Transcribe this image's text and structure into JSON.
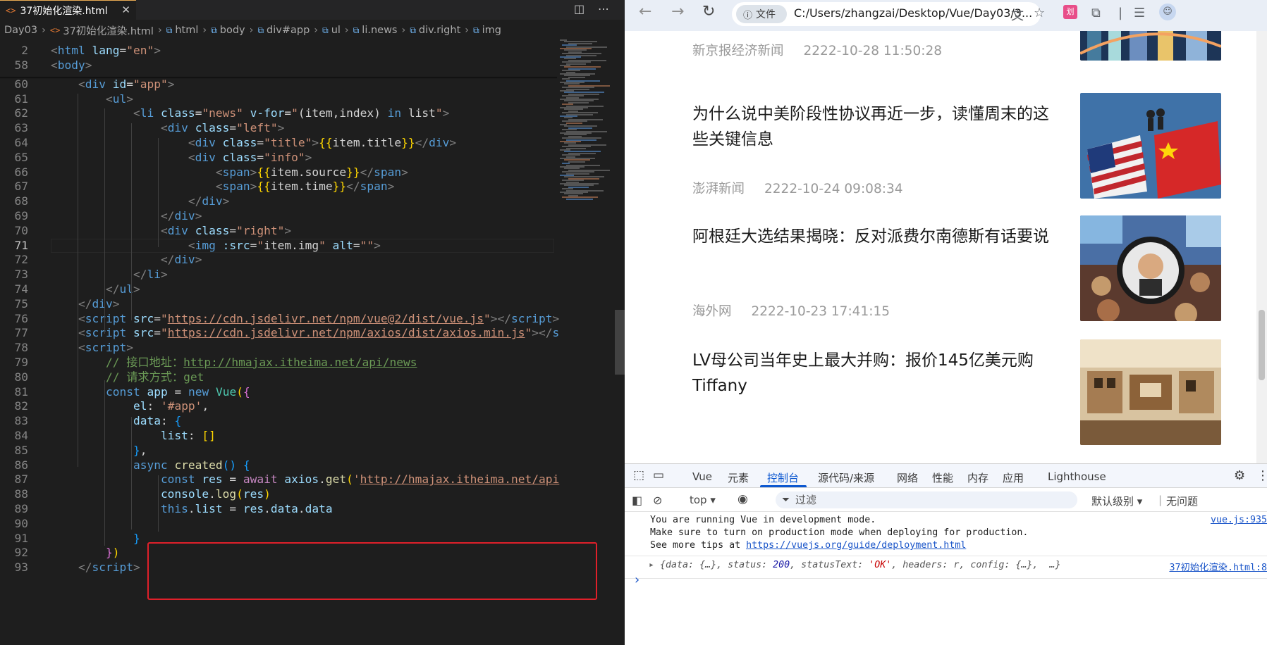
{
  "editor": {
    "tab": {
      "icon": "html-icon",
      "label": "37初始化渲染.html",
      "close": "✕"
    },
    "breadcrumb": [
      {
        "label": "Day03",
        "icon": ""
      },
      {
        "label": "37初始化渲染.html",
        "icon": "html-icon"
      },
      {
        "label": "html",
        "icon": "element-icon"
      },
      {
        "label": "body",
        "icon": "element-icon"
      },
      {
        "label": "div#app",
        "icon": "element-icon"
      },
      {
        "label": "ul",
        "icon": "element-icon"
      },
      {
        "label": "li.news",
        "icon": "element-icon"
      },
      {
        "label": "div.right",
        "icon": "element-icon"
      },
      {
        "label": "img",
        "icon": "element-icon"
      }
    ],
    "sticky_lines": [
      {
        "n": "2",
        "html": "<span class=\"p\">&lt;</span><span class=\"t\">html</span> <span class=\"a\">lang</span>=<span class=\"s\">\"en\"</span><span class=\"p\">&gt;</span>"
      },
      {
        "n": "58",
        "html": "<span class=\"p\">&lt;</span><span class=\"t\">body</span><span class=\"p\">&gt;</span>"
      }
    ],
    "lines": [
      {
        "n": "59",
        "html": ""
      },
      {
        "n": "60",
        "html": "    <span class=\"p\">&lt;</span><span class=\"t\">div</span> <span class=\"a\">id</span>=<span class=\"s\">\"app\"</span><span class=\"p\">&gt;</span>"
      },
      {
        "n": "61",
        "html": "        <span class=\"p\">&lt;</span><span class=\"t\">ul</span><span class=\"p\">&gt;</span>"
      },
      {
        "n": "62",
        "html": "            <span class=\"p\">&lt;</span><span class=\"t\">li</span> <span class=\"a\">class</span>=<span class=\"s\">\"news\"</span> <span class=\"a\">v-for</span>=<span class=\"s\">\"</span><span class=\"n\">(item,index) </span><span class=\"k\">in</span><span class=\"n\"> list</span><span class=\"s\">\"</span><span class=\"p\">&gt;</span>"
      },
      {
        "n": "63",
        "html": "                <span class=\"p\">&lt;</span><span class=\"t\">div</span> <span class=\"a\">class</span>=<span class=\"s\">\"left\"</span><span class=\"p\">&gt;</span>"
      },
      {
        "n": "64",
        "html": "                    <span class=\"p\">&lt;</span><span class=\"t\">div</span> <span class=\"a\">class</span>=<span class=\"s\">\"title\"</span><span class=\"p\">&gt;</span><span class=\"y\">{{</span><span class=\"n\">item.title</span><span class=\"y\">}}</span><span class=\"p\">&lt;/</span><span class=\"t\">div</span><span class=\"p\">&gt;</span>"
      },
      {
        "n": "65",
        "html": "                    <span class=\"p\">&lt;</span><span class=\"t\">div</span> <span class=\"a\">class</span>=<span class=\"s\">\"info\"</span><span class=\"p\">&gt;</span>"
      },
      {
        "n": "66",
        "html": "                        <span class=\"p\">&lt;</span><span class=\"t\">span</span><span class=\"p\">&gt;</span><span class=\"y\">{{</span><span class=\"n\">item.source</span><span class=\"y\">}}</span><span class=\"p\">&lt;/</span><span class=\"t\">span</span><span class=\"p\">&gt;</span>"
      },
      {
        "n": "67",
        "html": "                        <span class=\"p\">&lt;</span><span class=\"t\">span</span><span class=\"p\">&gt;</span><span class=\"y\">{{</span><span class=\"n\">item.time</span><span class=\"y\">}}</span><span class=\"p\">&lt;/</span><span class=\"t\">span</span><span class=\"p\">&gt;</span>"
      },
      {
        "n": "68",
        "html": "                    <span class=\"p\">&lt;/</span><span class=\"t\">div</span><span class=\"p\">&gt;</span>"
      },
      {
        "n": "69",
        "html": "                <span class=\"p\">&lt;/</span><span class=\"t\">div</span><span class=\"p\">&gt;</span>"
      },
      {
        "n": "70",
        "html": "                <span class=\"p\">&lt;</span><span class=\"t\">div</span> <span class=\"a\">class</span>=<span class=\"s\">\"right\"</span><span class=\"p\">&gt;</span>"
      },
      {
        "n": "71",
        "cur": true,
        "html": "                    <span class=\"p\">&lt;</span><span class=\"t\">img</span> <span class=\"a\">:src</span>=<span class=\"s\">\"</span><span class=\"n\">item.img</span><span class=\"s\">\"</span> <span class=\"a\">alt</span>=<span class=\"s\">\"\"</span><span class=\"p\">&gt;</span>"
      },
      {
        "n": "72",
        "html": "                <span class=\"p\">&lt;/</span><span class=\"t\">div</span><span class=\"p\">&gt;</span>"
      },
      {
        "n": "73",
        "html": "            <span class=\"p\">&lt;/</span><span class=\"t\">li</span><span class=\"p\">&gt;</span>"
      },
      {
        "n": "74",
        "html": "        <span class=\"p\">&lt;/</span><span class=\"t\">ul</span><span class=\"p\">&gt;</span>"
      },
      {
        "n": "75",
        "html": "    <span class=\"p\">&lt;/</span><span class=\"t\">div</span><span class=\"p\">&gt;</span>"
      },
      {
        "n": "76",
        "html": "    <span class=\"p\">&lt;</span><span class=\"t\">script</span> <span class=\"a\">src</span>=<span class=\"s\">\"<span class=\"u\">https://cdn.jsdelivr.net/npm/vue@2/dist/vue.js</span>\"</span><span class=\"p\">&gt;&lt;/</span><span class=\"t\">script</span><span class=\"p\">&gt;</span>"
      },
      {
        "n": "77",
        "html": "    <span class=\"p\">&lt;</span><span class=\"t\">script</span> <span class=\"a\">src</span>=<span class=\"s\">\"<span class=\"u\">https://cdn.jsdelivr.net/npm/axios/dist/axios.min.js</span>\"</span><span class=\"p\">&gt;&lt;/</span><span class=\"t\">s</span>"
      },
      {
        "n": "78",
        "html": "    <span class=\"p\">&lt;</span><span class=\"t\">script</span><span class=\"p\">&gt;</span>"
      },
      {
        "n": "79",
        "html": "        <span class=\"c\">// 接口地址：<span class=\"u\">http://hmajax.itheima.net/api/news</span></span>"
      },
      {
        "n": "80",
        "html": "        <span class=\"c\">// 请求方式：get</span>"
      },
      {
        "n": "81",
        "html": "        <span class=\"k\">const</span> <span class=\"a\">app</span> = <span class=\"k\">new</span> <span class=\"cls\">Vue</span><span class=\"y\">(</span><span class=\"pk\">{</span>"
      },
      {
        "n": "82",
        "html": "            <span class=\"a\">el</span>: <span class=\"s\">'#app'</span>,"
      },
      {
        "n": "83",
        "html": "            <span class=\"a\">data</span>: <span class=\"bl\">{</span>"
      },
      {
        "n": "84",
        "html": "                <span class=\"a\">list</span>: <span class=\"y\">[]</span>"
      },
      {
        "n": "85",
        "html": "            <span class=\"bl\">}</span>,"
      },
      {
        "n": "86",
        "html": "            <span class=\"k\">async</span> <span class=\"f\">created</span><span class=\"bl\">()</span> <span class=\"bl\">{</span>"
      },
      {
        "n": "87",
        "html": "                <span class=\"k\">const</span> <span class=\"a\">res</span> = <span class=\"v\">await</span> <span class=\"a\">axios</span>.<span class=\"f\">get</span><span class=\"y\">(</span><span class=\"s\">'<span class=\"u\">http://hmajax.itheima.net/api</span></span>"
      },
      {
        "n": "88",
        "html": "                <span class=\"a\">console</span>.<span class=\"f\">log</span><span class=\"y\">(</span><span class=\"a\">res</span><span class=\"y\">)</span>"
      },
      {
        "n": "89",
        "html": "                <span class=\"k\">this</span>.<span class=\"a\">list</span> = <span class=\"a\">res</span>.<span class=\"a\">data</span>.<span class=\"a\">data</span>"
      },
      {
        "n": "90",
        "html": ""
      },
      {
        "n": "91",
        "html": "            <span class=\"bl\">}</span>"
      },
      {
        "n": "92",
        "html": "        <span class=\"pk\">}</span><span class=\"y\">)</span>"
      },
      {
        "n": "93",
        "html": "    <span class=\"p\">&lt;/</span><span class=\"t\">script</span><span class=\"p\">&gt;</span>"
      }
    ]
  },
  "browser": {
    "back": "←",
    "forward": "→",
    "reload": "↻",
    "site_chip": "文件",
    "url": "C:/Users/zhangzai/Desktop/Vue/Day03/3...",
    "news": [
      {
        "title": "",
        "source": "新京报经济新闻",
        "time": "2222-10-28 11:50:28",
        "img": "city"
      },
      {
        "title": "为什么说中美阶段性协议再近一步，读懂周末的这些关键信息",
        "source": "澎湃新闻",
        "time": "2222-10-24 09:08:34",
        "img": "flags"
      },
      {
        "title": "阿根廷大选结果揭晓：反对派费尔南德斯有话要说",
        "source": "海外网",
        "time": "2222-10-23 17:41:15",
        "img": "crowd"
      },
      {
        "title": "LV母公司当年史上最大并购：报价145亿美元购Tiffany",
        "source": "",
        "time": "",
        "img": "store"
      }
    ]
  },
  "devtools": {
    "tabs": [
      "Vue",
      "元素",
      "控制台",
      "源代码/来源",
      "网络",
      "性能",
      "内存",
      "应用",
      "Lighthouse"
    ],
    "active_tab": "控制台",
    "context": "top ▾",
    "filter_placeholder": "过滤",
    "level": "默认级别 ▾",
    "issues": "无问题",
    "vue_msg_line1": "You are running Vue in development mode.",
    "vue_msg_line2": "Make sure to turn on production mode when deploying for production.",
    "vue_msg_line3_prefix": "See more tips at ",
    "vue_msg_link": "https://vuejs.org/guide/deployment.html",
    "vue_src": "vue.js:935",
    "obj_data": "data: {…}, ",
    "obj_status_key": "status: ",
    "obj_status": "200",
    "obj_statustext_key": ", statusText: ",
    "obj_statustext": "'OK'",
    "obj_rest": ", headers: r, config: {…},  …}",
    "obj_src": "37初始化渲染.html:8"
  }
}
